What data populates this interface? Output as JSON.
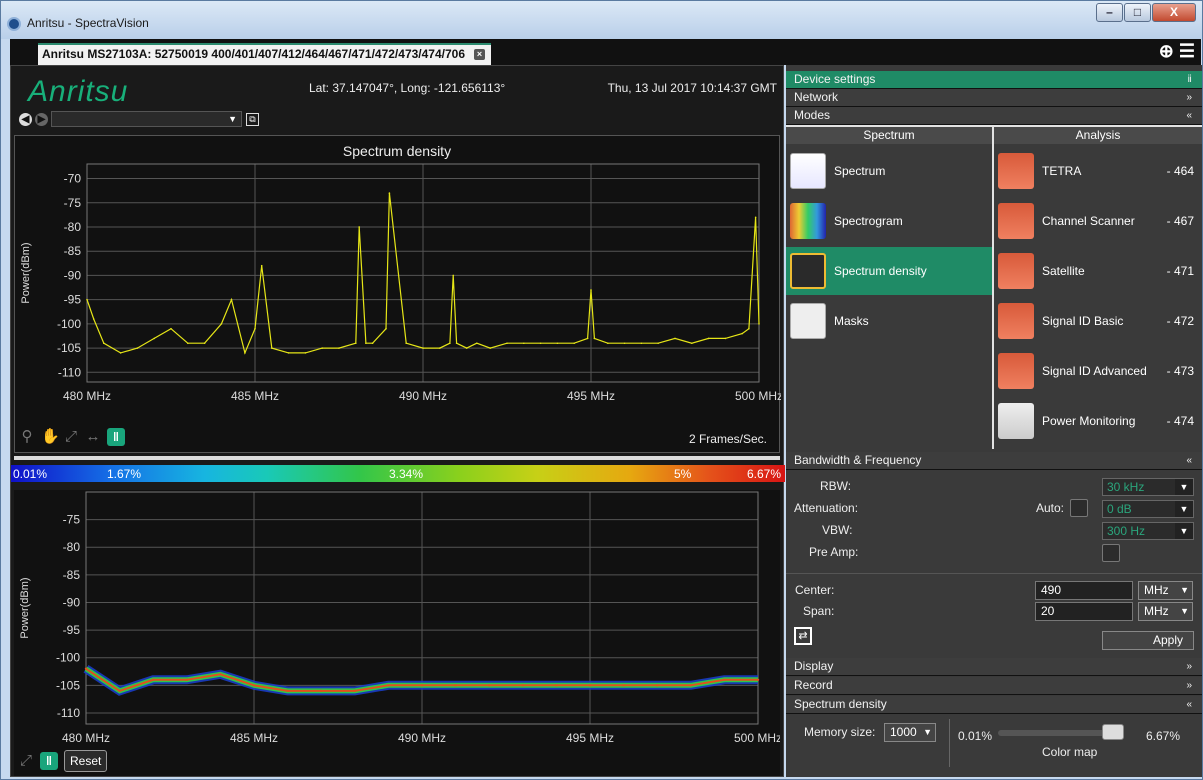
{
  "window": {
    "title": "Anritsu - SpectraVision",
    "minimize": "–",
    "maximize": "□",
    "close": "X"
  },
  "tab": {
    "label": "Anritsu MS27103A: 52750019 400/401/407/412/464/467/471/472/473/474/706",
    "close_glyph": "×"
  },
  "tab_actions": {
    "add_glyph": "⊕",
    "menu_glyph": "☰"
  },
  "header": {
    "logo": "Anritsu",
    "location": "Lat: 37.147047°, Long: -121.656113°",
    "datetime": "Thu, 13 Jul 2017 10:14:37 GMT"
  },
  "nav": {
    "back": "◀",
    "forward": "▶",
    "select_value": "",
    "dropdown_arrow": "▼",
    "export_glyph": "⧉"
  },
  "spectrum_chart": {
    "title": "Spectrum density",
    "ylabel": "Power(dBm)",
    "yticks": [
      "-70",
      "-75",
      "-80",
      "-85",
      "-90",
      "-95",
      "-100",
      "-105",
      "-110"
    ],
    "xticks": [
      "480 MHz",
      "485 MHz",
      "490 MHz",
      "495 MHz",
      "500 MHz"
    ],
    "fps": "2 Frames/Sec."
  },
  "chart_data": [
    {
      "type": "line",
      "title": "Spectrum density",
      "xlabel": "",
      "ylabel": "Power(dBm)",
      "xlim": [
        480,
        500
      ],
      "ylim": [
        -112,
        -67
      ],
      "grid": true,
      "x_unit": "MHz",
      "color": "#e6e617",
      "series": [
        {
          "x": [
            480,
            480.2,
            480.5,
            481,
            481.5,
            482,
            482.5,
            483,
            483.5,
            484,
            484.3,
            484.7,
            485,
            485.2,
            485.5,
            486,
            486.5,
            487,
            487.5,
            488,
            488.1,
            488.3,
            488.5,
            488.9,
            489,
            489.5,
            490,
            490.5,
            490.8,
            490.9,
            491,
            491.3,
            491.6,
            492,
            492.5,
            493,
            493.5,
            494,
            494.5,
            494.9,
            495,
            495.1,
            495.5,
            496,
            496.5,
            497,
            497.5,
            498,
            498.5,
            499,
            499.5,
            499.7,
            499.9,
            500
          ],
          "y": [
            -95,
            -99,
            -104,
            -106,
            -105,
            -103,
            -101,
            -104,
            -104,
            -100,
            -95,
            -106,
            -101,
            -88,
            -105,
            -106,
            -106,
            -105,
            -105,
            -104,
            -80,
            -104,
            -104,
            -101,
            -73,
            -104,
            -105,
            -105,
            -104,
            -90,
            -104,
            -105,
            -104,
            -105,
            -104,
            -104,
            -104,
            -104,
            -104,
            -103,
            -93,
            -103,
            -104,
            -104,
            -104,
            -104,
            -103,
            -104,
            -103,
            -103,
            -102,
            -101,
            -78,
            -100
          ]
        }
      ]
    },
    {
      "type": "heatmap",
      "title": "",
      "xlabel": "",
      "ylabel": "Power(dBm)",
      "xlim": [
        480,
        500
      ],
      "ylim": [
        -112,
        -70
      ],
      "grid": true,
      "colorscale_percent": [
        "0.01%",
        "1.67%",
        "3.34%",
        "5%",
        "6.67%"
      ],
      "series": [
        {
          "x": [
            480,
            481,
            482,
            483,
            484,
            485,
            486,
            487,
            488,
            489,
            490,
            491,
            492,
            493,
            494,
            495,
            496,
            497,
            498,
            499,
            500
          ],
          "y": [
            -102,
            -106,
            -104,
            -104,
            -103,
            -105,
            -106,
            -106,
            -106,
            -105,
            -105,
            -105,
            -105,
            -105,
            -105,
            -105,
            -105,
            -105,
            -105,
            -104,
            -104
          ]
        }
      ]
    }
  ],
  "density_chart": {
    "ylabel": "Power(dBm)",
    "yticks": [
      "-75",
      "-80",
      "-85",
      "-90",
      "-95",
      "-100",
      "-105",
      "-110"
    ],
    "xticks": [
      "480 MHz",
      "485 MHz",
      "490 MHz",
      "495 MHz",
      "500 MHz"
    ],
    "colorbar": [
      "0.01%",
      "1.67%",
      "3.34%",
      "5%",
      "6.67%"
    ],
    "reset": "Reset"
  },
  "settings": {
    "device_settings": "Device settings",
    "pin_glyph": "ⅱ",
    "network": "Network",
    "modes": "Modes",
    "col_spectrum": "Spectrum",
    "col_analysis": "Analysis",
    "spectrum_modes": [
      "Spectrum",
      "Spectrogram",
      "Spectrum density",
      "Masks"
    ],
    "analysis_modes": [
      {
        "label": "TETRA",
        "num": "- 464"
      },
      {
        "label": "Channel Scanner",
        "num": "- 467"
      },
      {
        "label": "Satellite",
        "num": "- 471"
      },
      {
        "label": "Signal ID Basic",
        "num": "- 472"
      },
      {
        "label": "Signal ID Advanced",
        "num": "- 473"
      },
      {
        "label": "Power Monitoring",
        "num": "- 474"
      }
    ],
    "bandwidth_header": "Bandwidth & Frequency",
    "rbw_label": "RBW:",
    "rbw_value": "30 kHz",
    "attenuation_label": "Attenuation:",
    "auto_label": "Auto:",
    "attenuation_value": "0 dB",
    "vbw_label": "VBW:",
    "vbw_value": "300 Hz",
    "preamp_label": "Pre Amp:",
    "center_label": "Center:",
    "center_value": "490",
    "center_unit": "MHz",
    "span_label": "Span:",
    "span_value": "20",
    "span_unit": "MHz",
    "apply": "Apply",
    "display": "Display",
    "record": "Record",
    "sd_header": "Spectrum density",
    "memory_label": "Memory size:",
    "memory_value": "1000",
    "slider_min": "0.01%",
    "slider_max": "6.67%",
    "slider_caption": "Color map",
    "slider_level_percent": 6.67
  },
  "colors": {
    "accent": "#1f8b66",
    "trace": "#e6e617",
    "panel": "#111111"
  }
}
